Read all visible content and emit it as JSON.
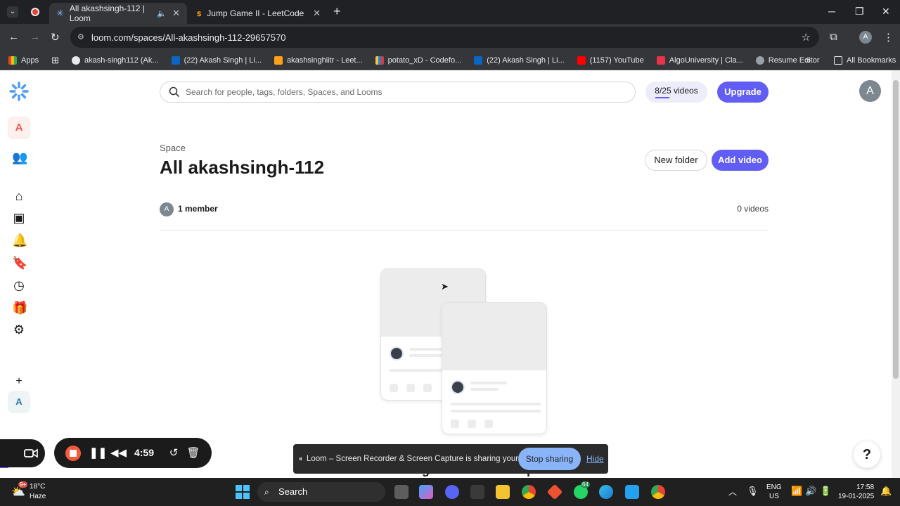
{
  "browser": {
    "tabs": [
      {
        "title": "All akashsingh-112 | Loom",
        "active": true
      },
      {
        "title": "Jump Game II - LeetCode",
        "active": false
      }
    ],
    "new_tab": "+",
    "url": "loom.com/spaces/All-akashsingh-112-29657570",
    "profile_initial": "A",
    "bookmarks": [
      {
        "label": "Apps",
        "icon": "apps-grid-icon"
      },
      {
        "label": "akash-singh112 (Ak...",
        "icon": "github-icon"
      },
      {
        "label": "(22) Akash Singh | Li...",
        "icon": "linkedin-icon"
      },
      {
        "label": "akashsinghiitr - Leet...",
        "icon": "leetcode-icon"
      },
      {
        "label": "potato_xD - Codefo...",
        "icon": "codeforces-icon"
      },
      {
        "label": "(22) Akash Singh | Li...",
        "icon": "linkedin-icon"
      },
      {
        "label": "(1157) YouTube",
        "icon": "youtube-icon"
      },
      {
        "label": "AlgoUniversity | Cla...",
        "icon": "algouniversity-icon"
      },
      {
        "label": "Resume Editor",
        "icon": "globe-icon"
      }
    ],
    "all_bookmarks": "All Bookmarks"
  },
  "sidebar": {
    "workspace_initial": "A",
    "bottom_initial": "A",
    "add": "+"
  },
  "header": {
    "search_placeholder": "Search for people, tags, folders, Spaces, and Looms",
    "quota": "8/25 videos",
    "upgrade": "Upgrade",
    "user_initial": "A"
  },
  "space": {
    "label": "Space",
    "title": "All akashsingh-112",
    "new_folder": "New folder",
    "add_video": "Add video",
    "member_initial": "A",
    "members": "1 member",
    "videos": "0 videos"
  },
  "empty_state": {
    "heading": "Start sharing videos to this Space"
  },
  "help": "?",
  "share_bar": {
    "pause_glyph": "⏸",
    "message": "Loom – Screen Recorder & Screen Capture is sharing your screen.",
    "stop": "Stop sharing",
    "hide": "Hide"
  },
  "recorder": {
    "timer": "4:59"
  },
  "taskbar": {
    "weather_temp": "18°C",
    "weather_desc": "Haze",
    "search": "Search",
    "whatsapp_badge": "64",
    "lang_top": "ENG",
    "lang_bottom": "US",
    "time": "17:58",
    "date": "19-01-2025",
    "weather_badge": "9+"
  },
  "colors": {
    "accent": "#625df5",
    "brand_logo": "#4e9cf3",
    "stop_button": "#8ab4f8",
    "record_stop": "#f85a3e"
  }
}
